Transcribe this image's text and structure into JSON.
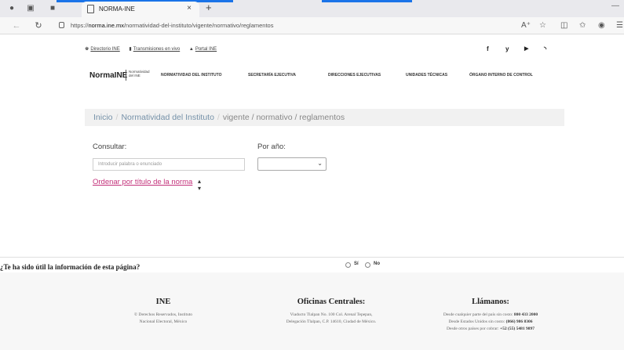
{
  "browser": {
    "tab_title": "NORMA-INE",
    "tab_close": "×",
    "new_tab": "+",
    "url_prefix": "https://",
    "url_host": "norma.ine.mx",
    "url_path": "/normatividad-del-instituto/vigente/normativo/reglamentos",
    "icons": [
      "profile-icon",
      "workspaces-icon",
      "tab-actions-icon",
      "back-icon",
      "refresh-icon",
      "lock-icon",
      "read-aloud-icon",
      "favorite-icon",
      "split-screen-icon",
      "favorites-icon",
      "collections-icon",
      "copilot-icon"
    ]
  },
  "utility": {
    "links": [
      "Directorio INE",
      "Transmisiones en vivo",
      "Portal INE"
    ],
    "social": [
      "f",
      "y",
      "▶",
      "◝"
    ]
  },
  "nav": {
    "logo": "NormaINE",
    "logo_sub": "Normatividad del INE",
    "items": [
      "NORMATIVIDAD DEL INSTITUTO",
      "SECRETARÍA EJECUTIVA",
      "DIRECCIONES EJECUTIVAS",
      "UNIDADES TÉCNICAS",
      "ÓRGANO INTERNO DE CONTROL"
    ]
  },
  "breadcrumb": {
    "home": "Inicio",
    "section": "Normatividad del Instituto",
    "rest": "vigente / normativo / reglamentos"
  },
  "filters": {
    "query_label": "Consultar:",
    "query_placeholder": "Introducir palabra o enunciado",
    "query_value": "",
    "year_label": "Por año:",
    "year_selected": "",
    "sort_label": "Ordenar por título de la norma"
  },
  "feedback": {
    "question": "¿Te ha sido útil la información de esta página?",
    "yes": "Sí",
    "no": "No"
  },
  "footer": {
    "ine": {
      "title": "INE",
      "lines": [
        "© Derechos Reservados, Instituto",
        "Nacional Electoral, México"
      ]
    },
    "offices": {
      "title": "Oficinas Centrales:",
      "lines": [
        "Viaducto Tlalpan No. 100 Col. Arenal Tepepan,",
        "Delegación Tlalpan, C.P. 14610, Ciudad de México."
      ]
    },
    "call": {
      "title": "Llámanos:",
      "l1_text": "Desde cualquier parte del país sin costo: ",
      "l1_num": "800 433 2000",
      "l2_text": "Desde Estados Unidos sin costo: ",
      "l2_num": "(866) 986 8306",
      "l3_text": "Desde otros países por cobrar: ",
      "l3_num": "+52 (55) 5481 9897"
    }
  }
}
